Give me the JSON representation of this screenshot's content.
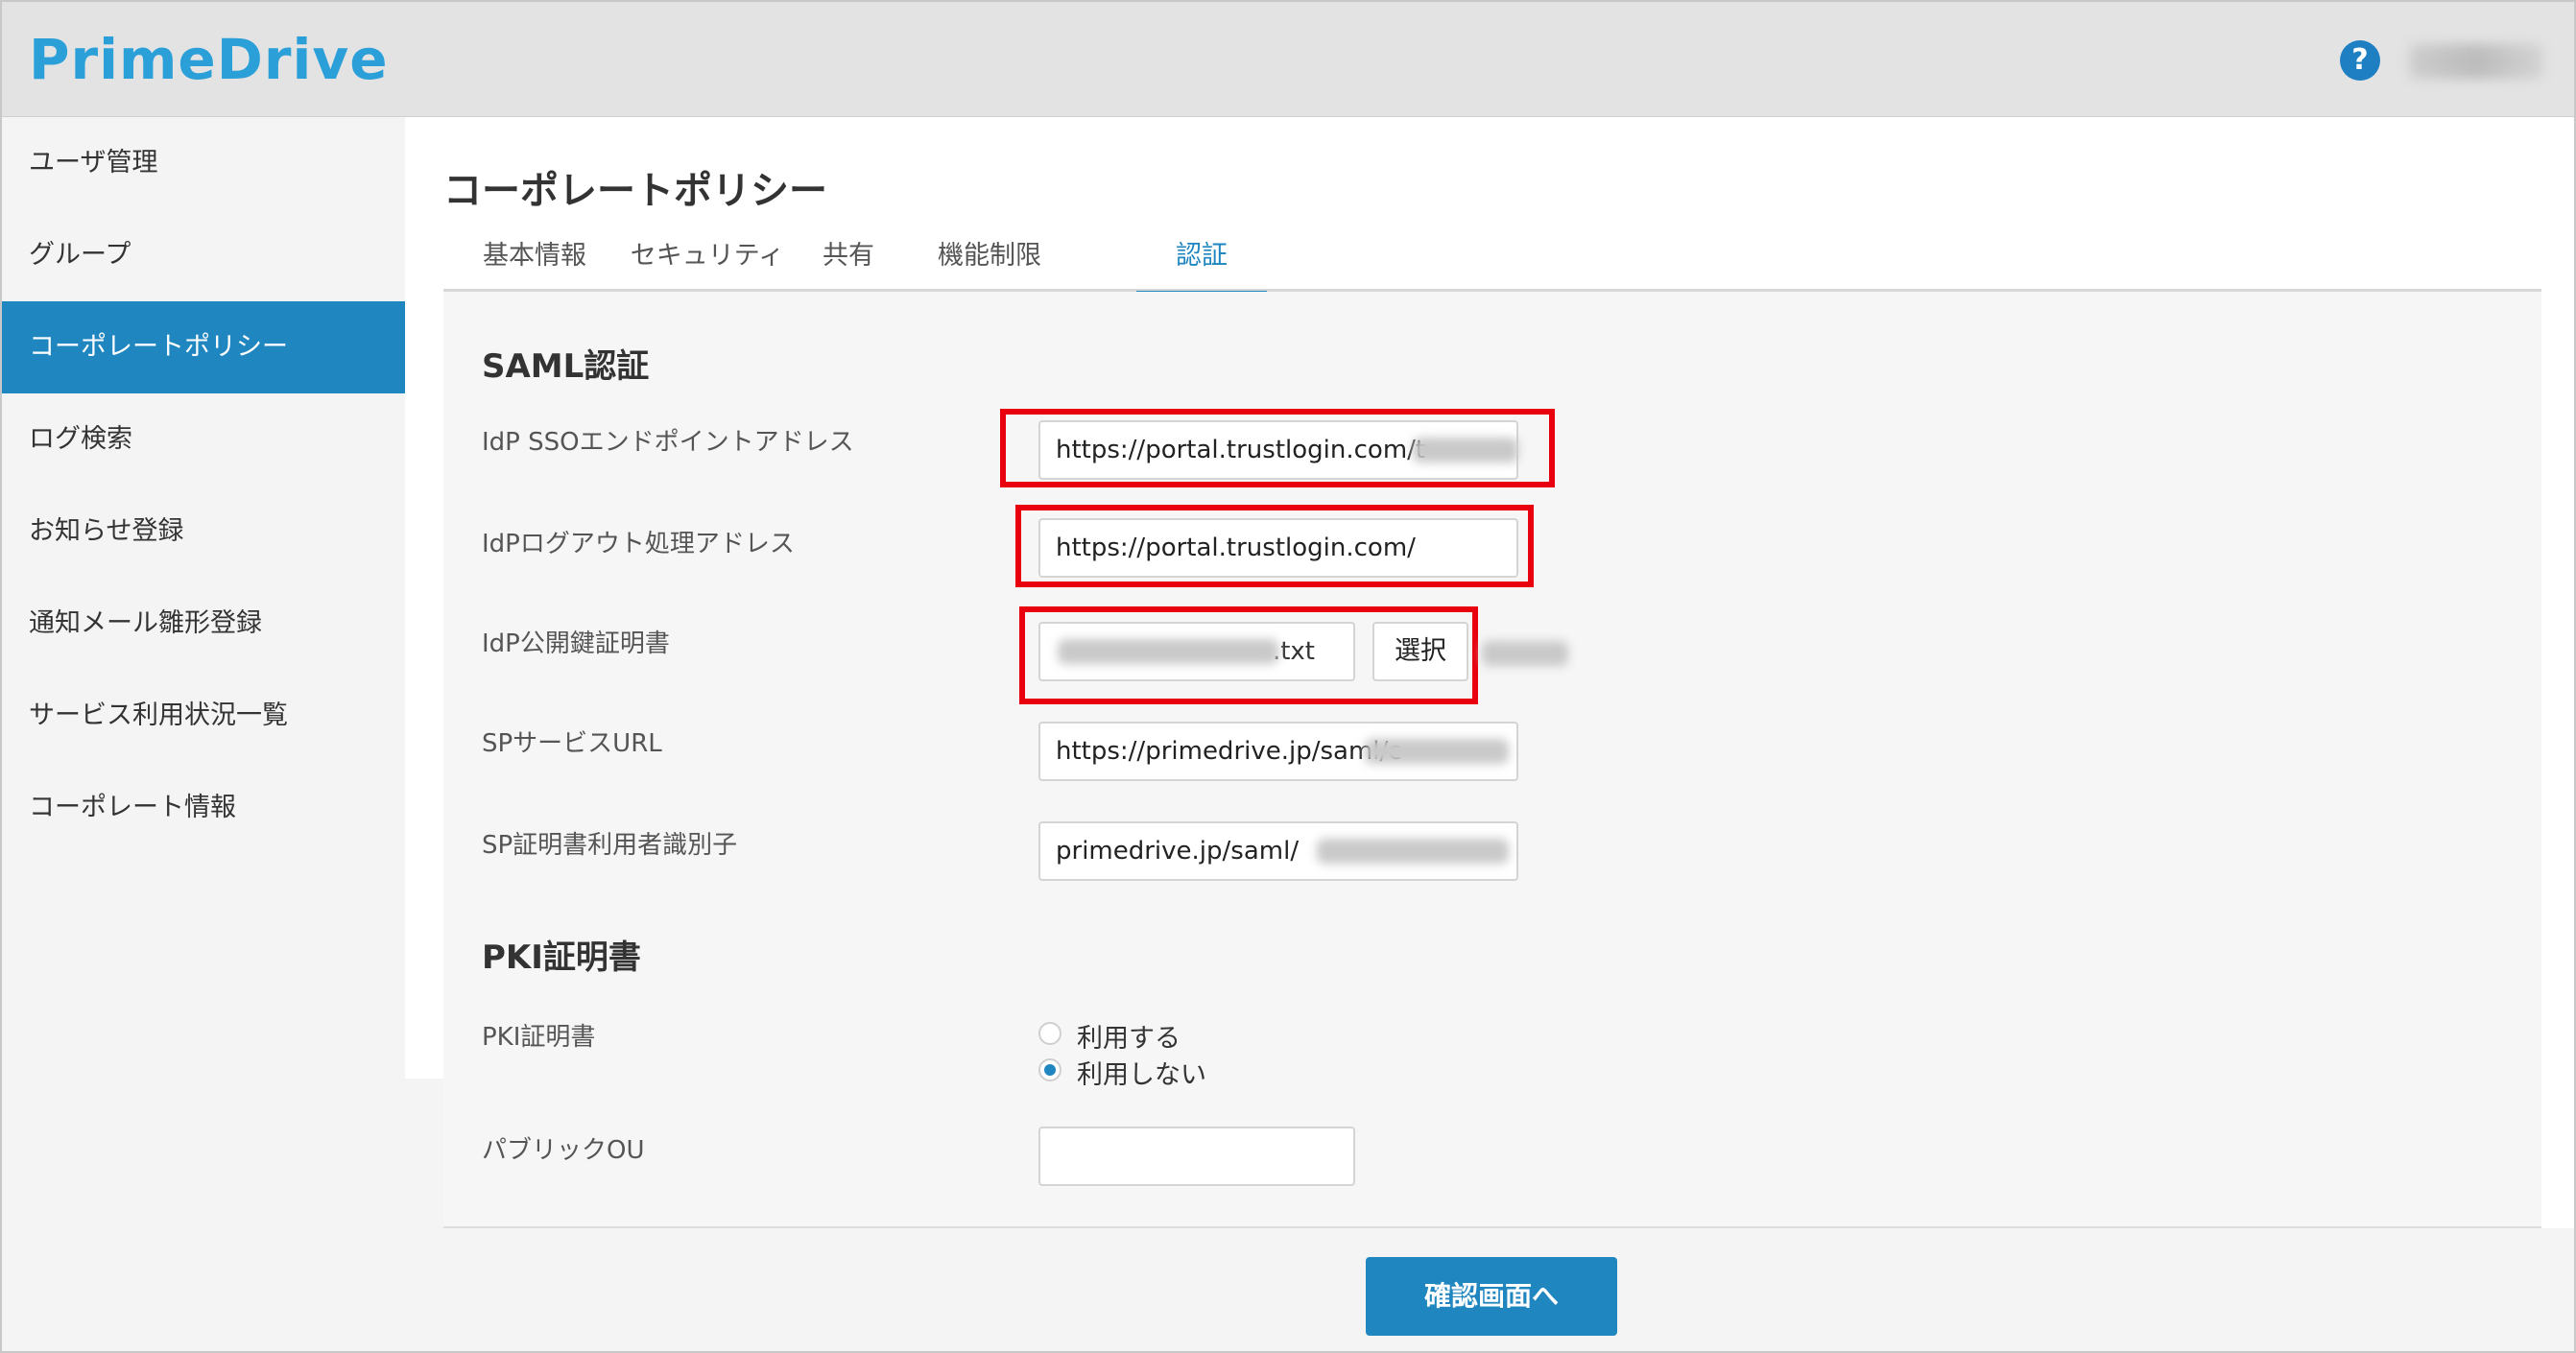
{
  "header": {
    "logo": "PrimeDrive",
    "help_icon": "question-circle-icon",
    "help_glyph": "?"
  },
  "sidebar": {
    "items": [
      {
        "label": "ユーザ管理"
      },
      {
        "label": "グループ"
      },
      {
        "label": "コーポレートポリシー",
        "active": true
      },
      {
        "label": "ログ検索"
      },
      {
        "label": "お知らせ登録"
      },
      {
        "label": "通知メール雛形登録"
      },
      {
        "label": "サービス利用状況一覧"
      },
      {
        "label": "コーポレート情報"
      }
    ]
  },
  "main": {
    "title": "コーポレートポリシー",
    "tabs": [
      {
        "label": "基本情報"
      },
      {
        "label": "セキュリティ"
      },
      {
        "label": "共有"
      },
      {
        "label": "機能制限"
      },
      {
        "label": "認証",
        "active": true
      }
    ],
    "saml": {
      "title": "SAML認証",
      "fields": [
        {
          "label": "IdP SSOエンドポイントアドレス",
          "value": "https://portal.trustlogin.com/t"
        },
        {
          "label": "IdPログアウト処理アドレス",
          "value": "https://portal.trustlogin.com/"
        },
        {
          "label": "IdP公開鍵証明書",
          "file_value": ".txt",
          "button": "選択"
        },
        {
          "label": "SPサービスURL",
          "value": "https://primedrive.jp/saml/c"
        },
        {
          "label": "SP証明書利用者識別子",
          "value": "primedrive.jp/saml/"
        }
      ]
    },
    "pki": {
      "title": "PKI証明書",
      "label": "PKI証明書",
      "options": [
        {
          "label": "利用する",
          "selected": false
        },
        {
          "label": "利用しない",
          "selected": true
        }
      ],
      "public_ou_label": "パブリックOU",
      "public_ou_value": ""
    },
    "confirm_button": "確認画面へ"
  },
  "colors": {
    "accent": "#1f86c0",
    "highlight": "#e8000f",
    "logo": "#2a9fd8"
  }
}
